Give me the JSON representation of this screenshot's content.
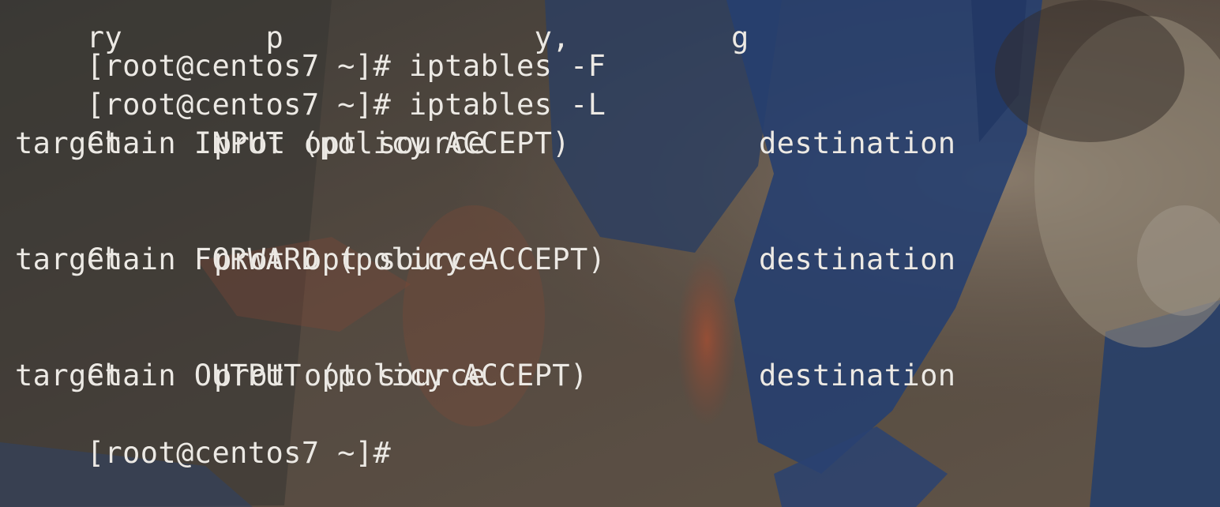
{
  "terminal": {
    "partial_top_line": "ry        p              y,         g",
    "prompt": "[root@centos7 ~]#",
    "commands": [
      "iptables -F",
      "iptables -L"
    ],
    "chains": [
      {
        "header": "Chain INPUT (policy ACCEPT)",
        "columns": [
          "target",
          "prot",
          "opt",
          "source",
          "destination"
        ]
      },
      {
        "header": "Chain FORWARD (policy ACCEPT)",
        "columns": [
          "target",
          "prot",
          "opt",
          "source",
          "destination"
        ]
      },
      {
        "header": "Chain OUTPUT (policy ACCEPT)",
        "columns": [
          "target",
          "prot",
          "opt",
          "source",
          "destination"
        ]
      }
    ],
    "text_color": "#ece9e4"
  },
  "wallpaper": {
    "description_colors": [
      "#2c4f8f",
      "#c9603f",
      "#7a6a5c",
      "#d8cdbd"
    ]
  }
}
